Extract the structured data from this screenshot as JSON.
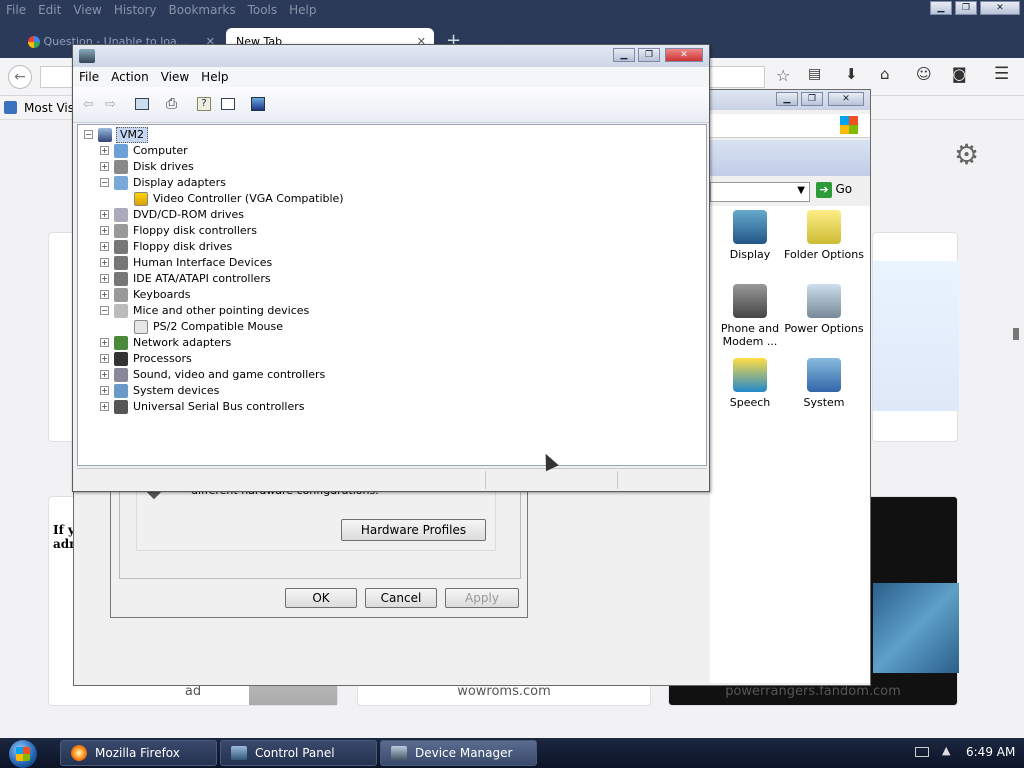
{
  "firefox": {
    "menu": [
      "File",
      "Edit",
      "View",
      "History",
      "Bookmarks",
      "Tools",
      "Help"
    ],
    "tabs": [
      {
        "label": "Question - Unable to loa..."
      },
      {
        "label": "New Tab"
      }
    ],
    "bookmarks_label": "Most Visi",
    "tiles": [
      {
        "label": "ad"
      },
      {
        "label": "wowroms.com"
      },
      {
        "label": "powerrangers.fandom.com"
      }
    ],
    "left_tile_text": "If yo adm"
  },
  "control_panel": {
    "go_label": "Go",
    "items": [
      {
        "label": "Display",
        "icon": "display-icon"
      },
      {
        "label": "Folder Options",
        "icon": "folder-options-icon"
      },
      {
        "label": "Phone and Modem ...",
        "icon": "phone-modem-icon"
      },
      {
        "label": "Power Options",
        "icon": "power-options-icon"
      },
      {
        "label": "Speech",
        "icon": "speech-icon"
      },
      {
        "label": "System",
        "icon": "system-icon"
      }
    ]
  },
  "dialog": {
    "text": "different hardware configurations.",
    "hardware_profiles": "Hardware Profiles",
    "ok": "OK",
    "cancel": "Cancel",
    "apply": "Apply"
  },
  "device_manager": {
    "menu": [
      "File",
      "Action",
      "View",
      "Help"
    ],
    "root": "VM2",
    "tree": [
      {
        "label": "Computer",
        "expanded": false
      },
      {
        "label": "Disk drives",
        "expanded": false
      },
      {
        "label": "Display adapters",
        "expanded": true,
        "children": [
          "Video Controller (VGA Compatible)"
        ]
      },
      {
        "label": "DVD/CD-ROM drives",
        "expanded": false
      },
      {
        "label": "Floppy disk controllers",
        "expanded": false
      },
      {
        "label": "Floppy disk drives",
        "expanded": false
      },
      {
        "label": "Human Interface Devices",
        "expanded": false
      },
      {
        "label": "IDE ATA/ATAPI controllers",
        "expanded": false
      },
      {
        "label": "Keyboards",
        "expanded": false
      },
      {
        "label": "Mice and other pointing devices",
        "expanded": true,
        "children": [
          "PS/2 Compatible Mouse"
        ]
      },
      {
        "label": "Network adapters",
        "expanded": false
      },
      {
        "label": "Processors",
        "expanded": false
      },
      {
        "label": "Sound, video and game controllers",
        "expanded": false
      },
      {
        "label": "System devices",
        "expanded": false
      },
      {
        "label": "Universal Serial Bus controllers",
        "expanded": false
      }
    ]
  },
  "taskbar": {
    "tasks": [
      {
        "label": "Mozilla Firefox"
      },
      {
        "label": "Control Panel"
      },
      {
        "label": "Device Manager"
      }
    ],
    "time": "6:49 AM"
  },
  "colors": {
    "firefox_chrome": "#2c3a5a",
    "taskbar": "#0b1326",
    "selection": "#c5d7f2",
    "tree_border": "#9aa3b4"
  }
}
